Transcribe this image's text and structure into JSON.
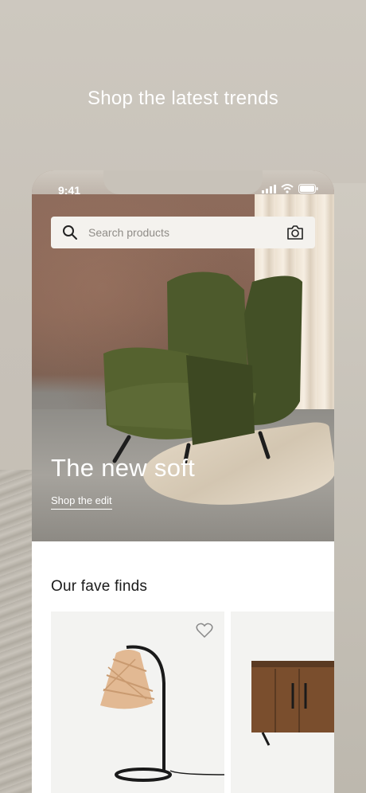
{
  "headline": "Shop the latest trends",
  "status": {
    "time": "9:41"
  },
  "search": {
    "placeholder": "Search products"
  },
  "hero": {
    "title": "The new soft",
    "link": "Shop the edit"
  },
  "section": {
    "title": "Our fave finds"
  },
  "icons": [
    "search-icon",
    "camera-icon",
    "heart-icon",
    "signal-icon",
    "wifi-icon",
    "battery-icon"
  ]
}
